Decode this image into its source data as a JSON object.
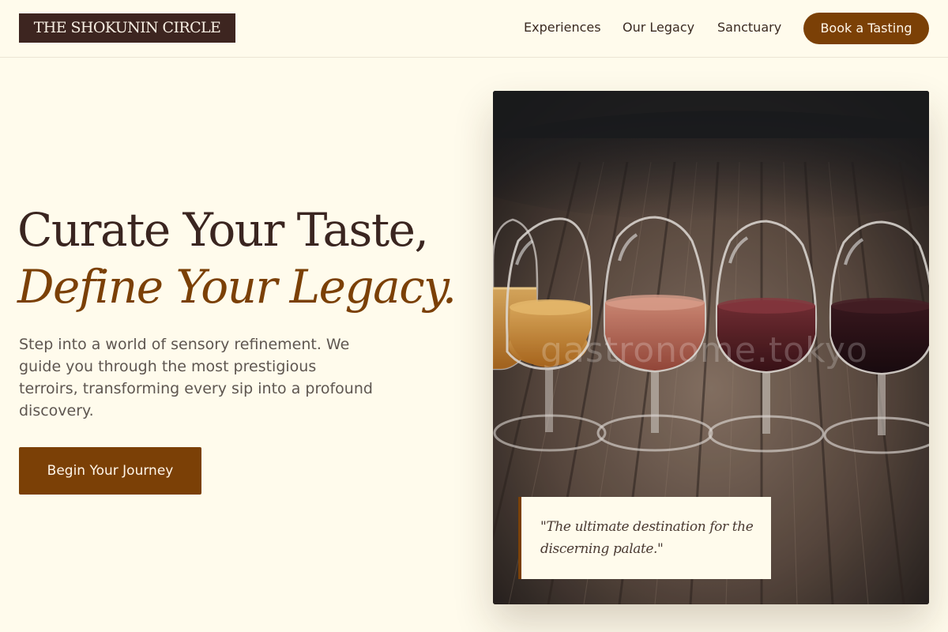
{
  "brand": {
    "logo_text": "THE SHOKUNIN CIRCLE",
    "accent_color": "#7b4006",
    "logo_bg": "#3d2520",
    "page_bg": "#fffbec"
  },
  "nav": {
    "items": [
      {
        "label": "Experiences"
      },
      {
        "label": "Our Legacy"
      },
      {
        "label": "Sanctuary"
      }
    ],
    "cta_label": "Book a Tasting"
  },
  "hero": {
    "headline_line1": "Curate Your Taste,",
    "headline_line2": "Define Your Legacy.",
    "description": "Step into a world of sensory refinement. We guide you through the most prestigious terroirs, transforming every sip into a profound discovery.",
    "cta_label": "Begin Your Journey",
    "image": {
      "subject": "four wine glasses with amber, rosé, garnet and deep red wine on a wooden barrel top",
      "watermark": "gastronome.tokyo"
    },
    "quote": "\"The ultimate destination for the discerning palate.\""
  }
}
